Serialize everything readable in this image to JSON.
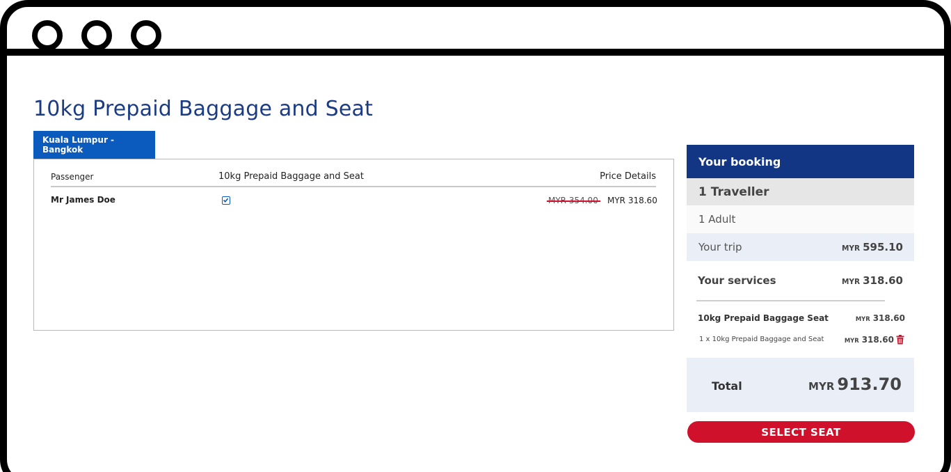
{
  "page": {
    "title": "10kg Prepaid Baggage and Seat"
  },
  "route_tab": {
    "label": "Kuala Lumpur - Bangkok"
  },
  "table": {
    "headers": {
      "passenger": "Passenger",
      "service": "10kg Prepaid Baggage and Seat",
      "price": "Price Details"
    },
    "rows": [
      {
        "name": "Mr James Doe",
        "selected": true,
        "old_price": "MYR 354.00",
        "new_price": "MYR 318.60"
      }
    ]
  },
  "booking": {
    "title": "Your booking",
    "travellers": "1 Traveller",
    "adults": "1 Adult",
    "trip_label": "Your trip",
    "trip_currency": "MYR",
    "trip_amount": "595.10",
    "services_label": "Your services",
    "services_currency": "MYR",
    "services_amount": "318.60",
    "service_item": "10kg Prepaid Baggage Seat",
    "service_item_currency": "MYR",
    "service_item_amount": "318.60",
    "service_line": "1 x 10kg Prepaid Baggage and Seat",
    "service_line_currency": "MYR",
    "service_line_amount": "318.60",
    "total_label": "Total",
    "total_currency": "MYR",
    "total_amount": "913.70"
  },
  "actions": {
    "select_seat": "SELECT SEAT"
  },
  "colors": {
    "brand_blue": "#123584",
    "tab_blue": "#0b5bbf",
    "accent_red": "#d0112b",
    "title_blue": "#1b3b82"
  }
}
